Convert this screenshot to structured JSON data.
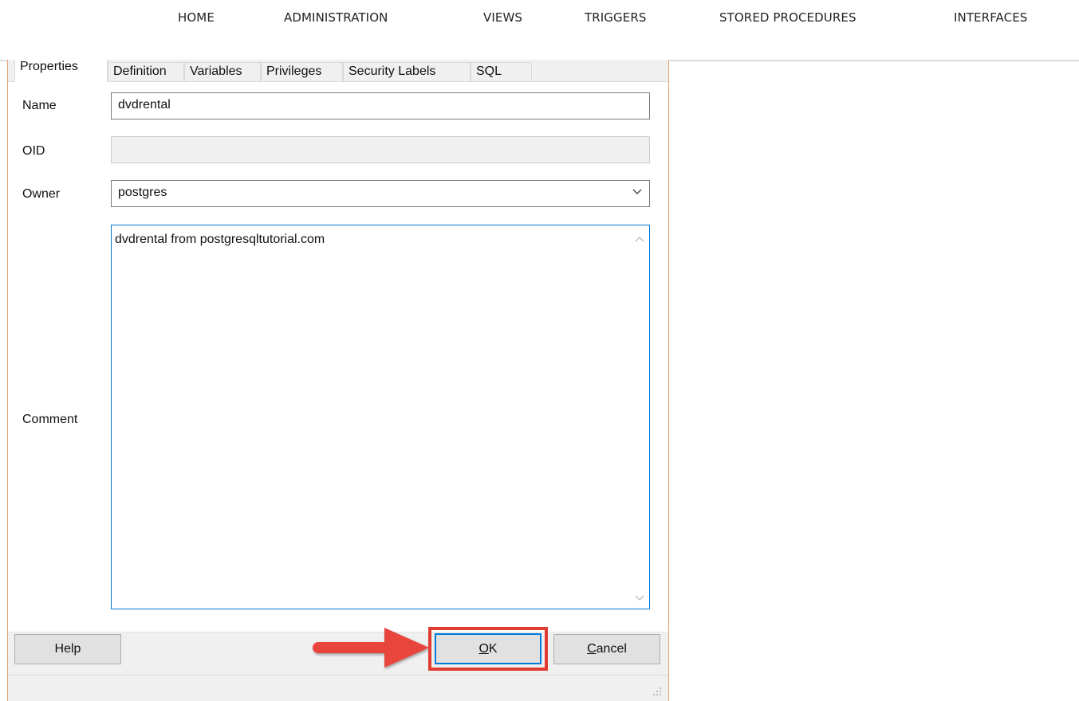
{
  "nav": {
    "items": [
      "HOME",
      "ADMINISTRATION",
      "VIEWS",
      "TRIGGERS",
      "STORED PROCEDURES",
      "INTERFACES"
    ]
  },
  "tabs": [
    "Properties",
    "Definition",
    "Variables",
    "Privileges",
    "Security Labels",
    "SQL"
  ],
  "active_tab": "Properties",
  "form": {
    "name_label": "Name",
    "name_value": "dvdrental",
    "oid_label": "OID",
    "oid_value": "",
    "owner_label": "Owner",
    "owner_value": "postgres",
    "comment_label": "Comment",
    "comment_value": "dvdrental from postgresqltutorial.com"
  },
  "buttons": {
    "help": "Help",
    "ok": "OK",
    "cancel": "Cancel"
  },
  "colors": {
    "highlight": "#e03c31",
    "focus": "#0078d7"
  },
  "icons": {
    "owner_dropdown": "chevron-down-icon",
    "scroll_up": "scroll-up-icon",
    "scroll_down": "scroll-down-icon",
    "annotation_arrow": "red-arrow-icon",
    "resize": "resize-grip-icon"
  }
}
